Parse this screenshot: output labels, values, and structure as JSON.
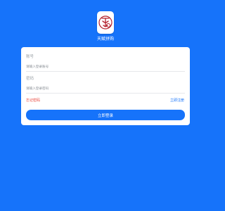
{
  "app": {
    "name": "天赋拼购"
  },
  "form": {
    "account_label": "账号",
    "account_placeholder": "请输入登录账号",
    "password_label": "密码",
    "password_placeholder": "请输入登录密码",
    "forgot_link": "忘记密码",
    "register_link": "立即注册",
    "login_button": "立即登录"
  },
  "colors": {
    "background": "#1673fa",
    "card": "#ffffff",
    "forgot_link": "#e8453c",
    "register_link": "#1673fa",
    "button": "#1673fa"
  }
}
